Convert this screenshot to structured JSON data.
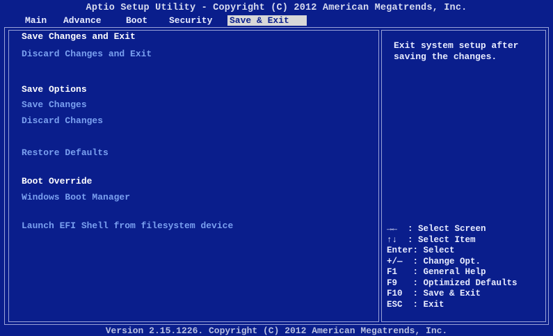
{
  "header": {
    "title": "Aptio Setup Utility - Copyright (C) 2012 American Megatrends, Inc."
  },
  "tabs": [
    {
      "label": "Main"
    },
    {
      "label": "Advance"
    },
    {
      "label": "Boot"
    },
    {
      "label": "Security"
    },
    {
      "label": "Save & Exit",
      "active": true
    }
  ],
  "menu": {
    "save_changes_and_exit": "Save Changes and Exit",
    "discard_changes_and_exit": "Discard Changes and Exit",
    "save_options_heading": "Save Options",
    "save_changes": "Save Changes",
    "discard_changes": "Discard Changes",
    "restore_defaults": "Restore Defaults",
    "boot_override_heading": "Boot Override",
    "windows_boot_manager": "Windows Boot Manager",
    "launch_efi_shell": "Launch EFI Shell from filesystem device"
  },
  "help": {
    "text": "Exit system setup after saving the changes."
  },
  "keys": [
    "→←  : Select Screen",
    "↑↓  : Select Item",
    "Enter: Select",
    "+/—  : Change Opt.",
    "F1   : General Help",
    "F9   : Optimized Defaults",
    "F10  : Save & Exit",
    "ESC  : Exit"
  ],
  "footer": {
    "text": "Version 2.15.1226. Copyright (C) 2012 American Megatrends, Inc."
  },
  "colors": {
    "background": "#0a1e8c",
    "active_tab_bg": "#d8d8d8",
    "menu_item": "#7aa0f0",
    "text": "#ffffff"
  }
}
